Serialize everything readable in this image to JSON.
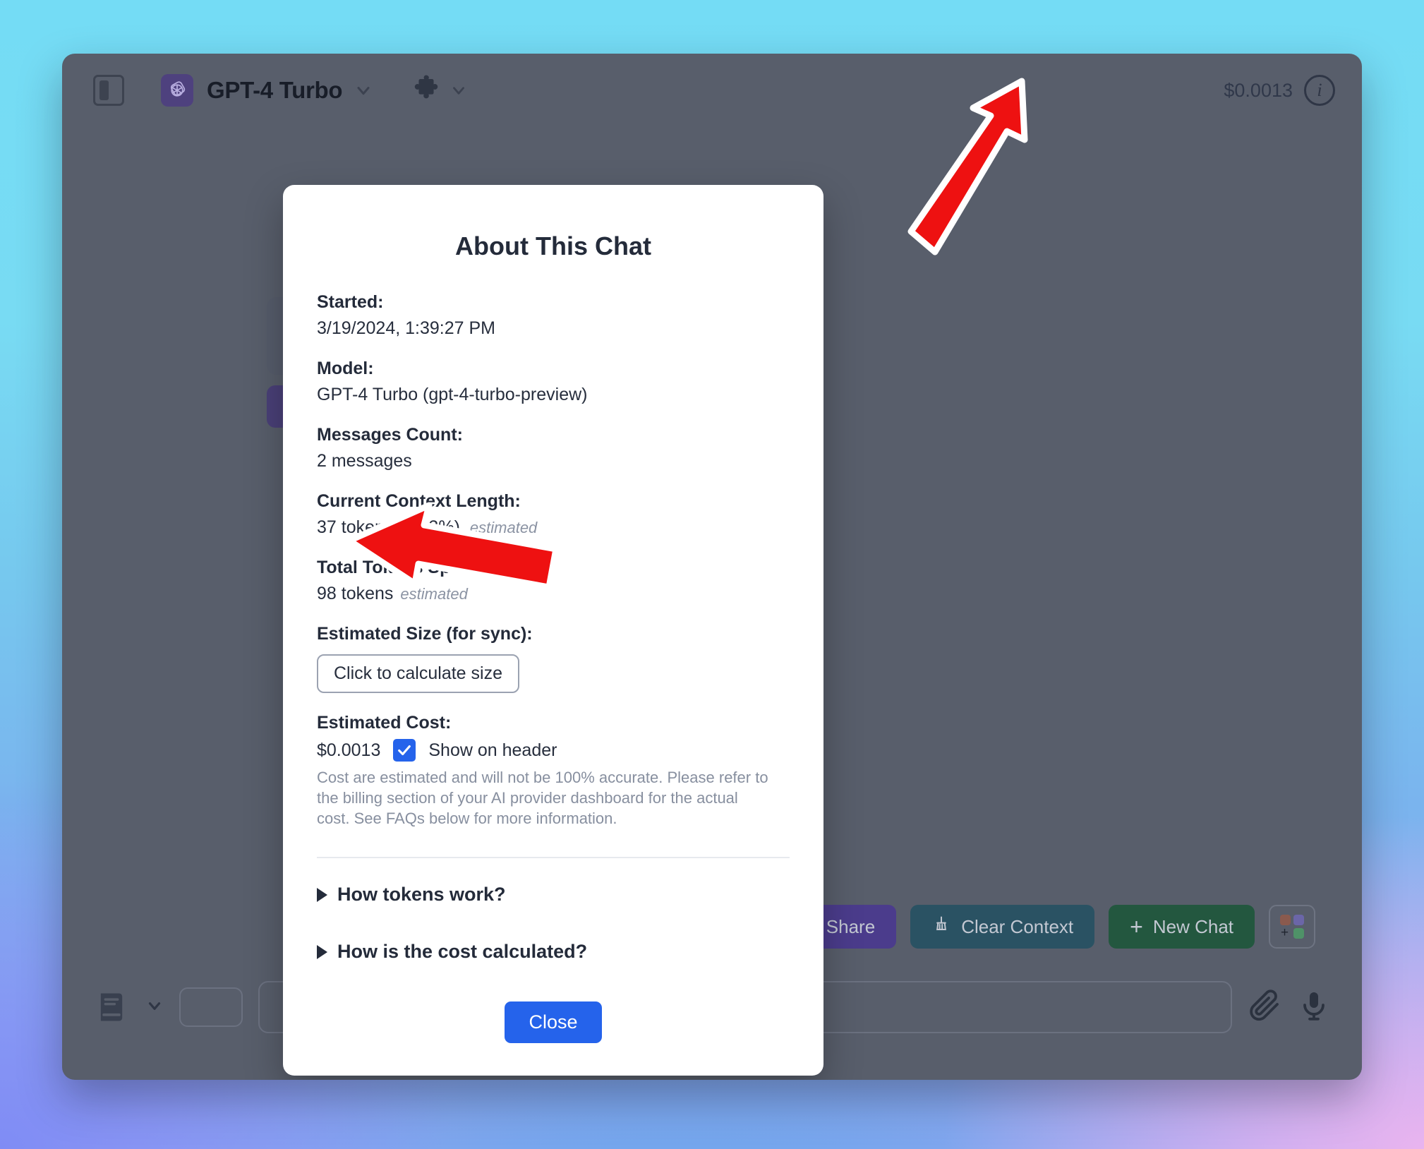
{
  "window": {
    "header": {
      "sidebar_toggle_name": "sidebar-toggle",
      "model_label": "GPT-4 Turbo",
      "cost_label": "$0.0013",
      "info_glyph": "i"
    },
    "action_bar": {
      "share_label": "Share",
      "clear_context_label": "Clear Context",
      "new_chat_label": "New Chat",
      "new_chat_plus": "+",
      "grid_plus": "+"
    }
  },
  "modal": {
    "title": "About This Chat",
    "fields": [
      {
        "label": "Started:",
        "value": "3/19/2024, 1:39:27 PM"
      },
      {
        "label": "Model:",
        "value": "GPT-4 Turbo (gpt-4-turbo-preview)"
      },
      {
        "label": "Messages Count:",
        "value": "2 messages"
      },
      {
        "label": "Current Context Length:",
        "value": "37 tokens (0.03%)",
        "note": "estimated"
      },
      {
        "label": "Total Tokens Spent:",
        "value": "98 tokens",
        "note": "estimated"
      }
    ],
    "size": {
      "label": "Estimated Size (for sync):",
      "button_label": "Click to calculate size"
    },
    "cost": {
      "label": "Estimated Cost:",
      "value": "$0.0013",
      "checkbox_checked": true,
      "checkbox_label": "Show on header",
      "caption": "Cost are estimated and will not be 100% accurate. Please refer to the billing section of your AI provider dashboard for the actual cost. See FAQs below for more information."
    },
    "faqs": [
      {
        "label": "How tokens work?"
      },
      {
        "label": "How is the cost calculated?"
      }
    ],
    "close_label": "Close"
  },
  "colors": {
    "accent_blue": "#2563eb",
    "share_purple": "#4b3c8c",
    "clear_teal": "#2a5263",
    "new_chat_green": "#23573f",
    "window_bg": "#585e6b",
    "annotation_red": "#ee1111"
  }
}
